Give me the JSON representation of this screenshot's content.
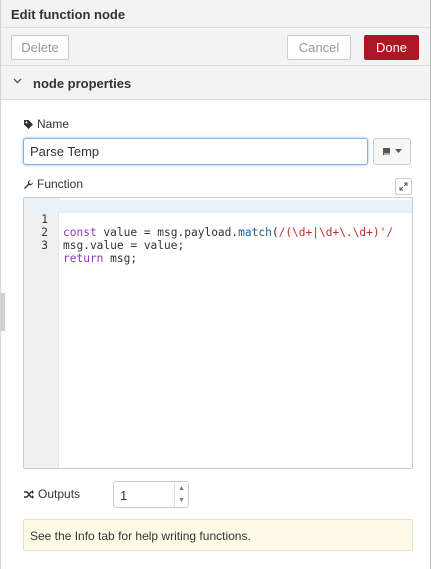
{
  "header": {
    "title": "Edit function node"
  },
  "toolbar": {
    "delete_label": "Delete",
    "cancel_label": "Cancel",
    "done_label": "Done"
  },
  "section": {
    "title": "node properties"
  },
  "name_field": {
    "label": "Name",
    "value": "Parse Temp"
  },
  "function_field": {
    "label": "Function",
    "lines": [
      {
        "number": "1",
        "text": "const value = msg.payload.match(/(\\d+|\\d+\\.\\d+)'/"
      },
      {
        "number": "2",
        "text": "msg.value = value;"
      },
      {
        "number": "3",
        "text": "return msg;"
      }
    ]
  },
  "outputs": {
    "label": "Outputs",
    "value": "1"
  },
  "tip": {
    "text": "See the Info tab for help writing functions."
  },
  "colors": {
    "accent": "#ad1625",
    "keyword": "#8e3bb8",
    "regex": "#c03030"
  }
}
